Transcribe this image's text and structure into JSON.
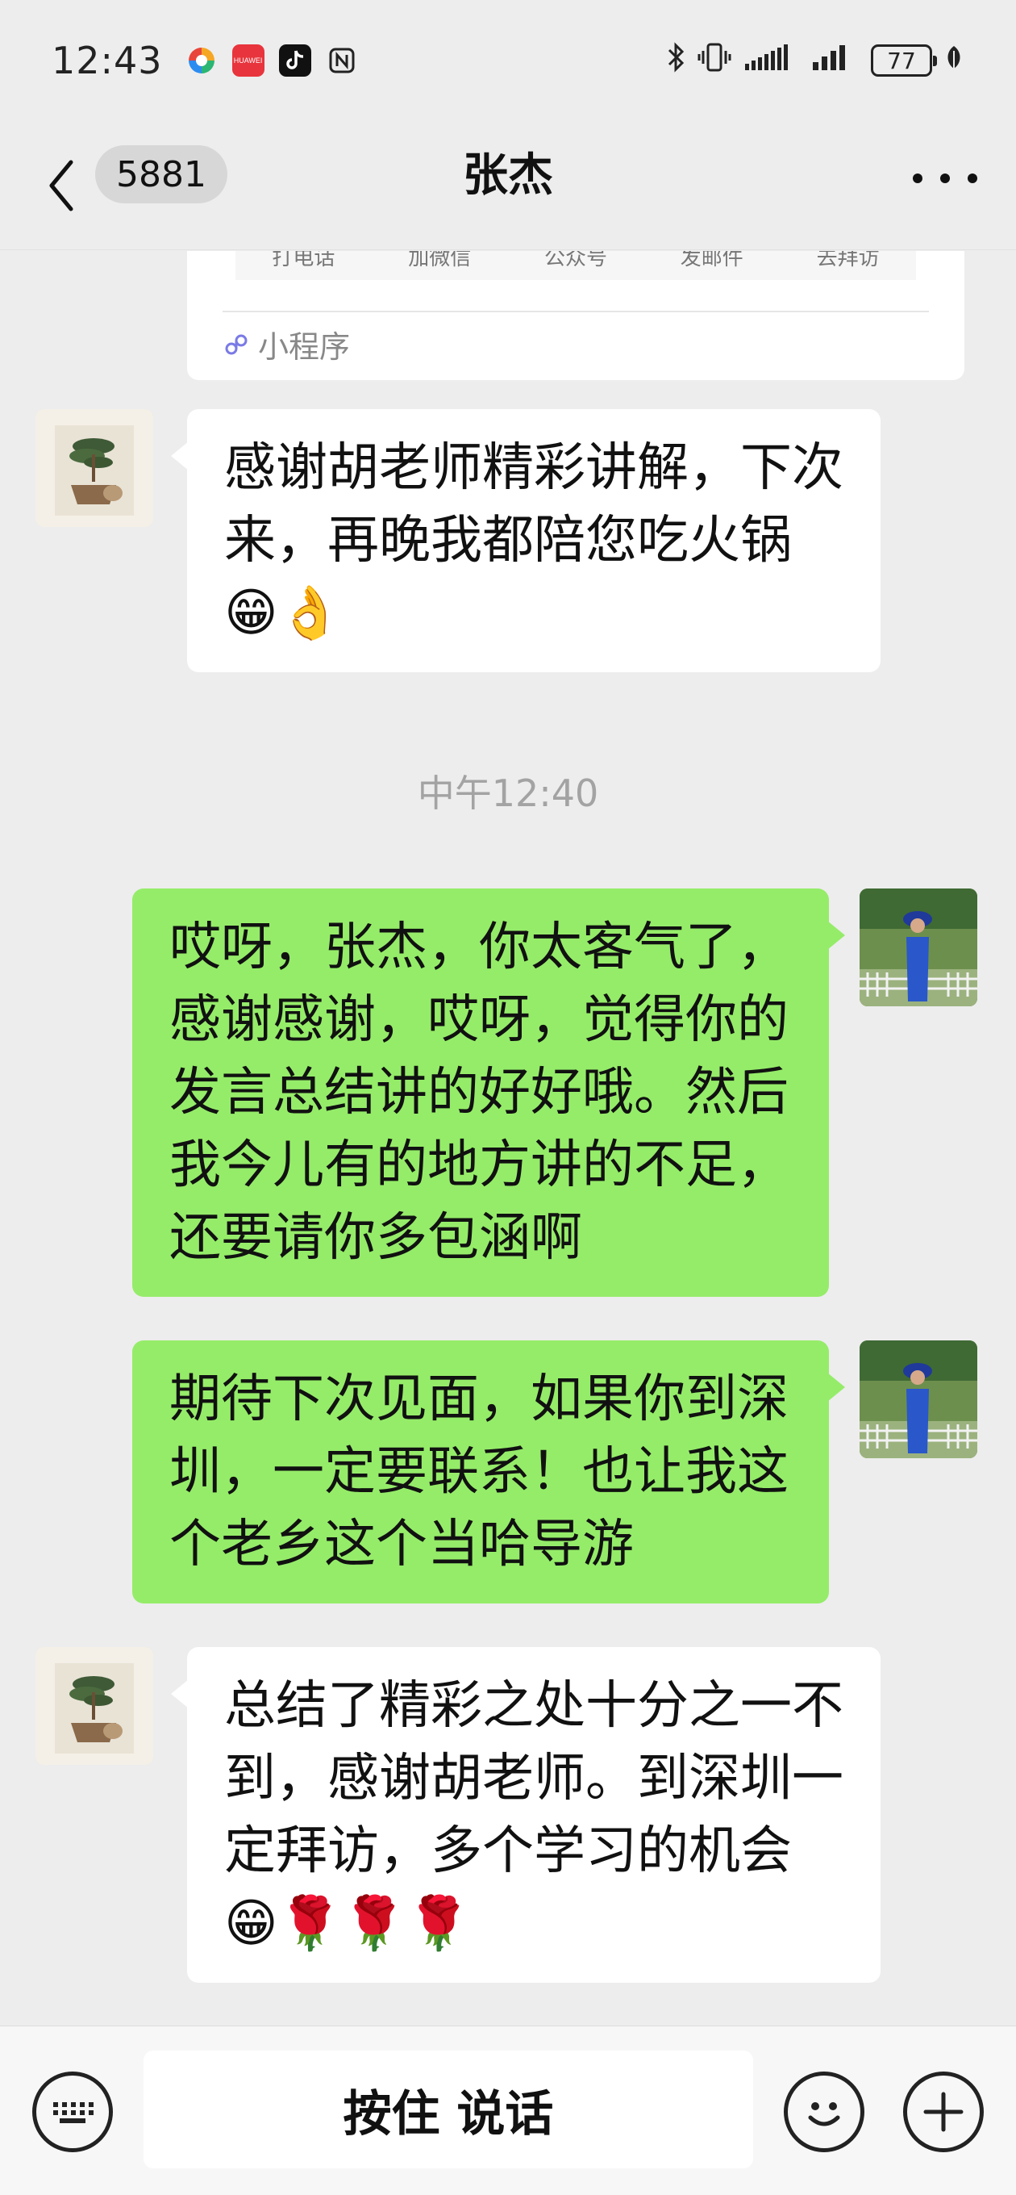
{
  "status_bar": {
    "time": "12:43",
    "battery": "77",
    "huawei_label": "HUAWEI"
  },
  "header": {
    "unread_count": "5881",
    "title": "张杰"
  },
  "mini_program": {
    "actions": [
      "打电话",
      "加微信",
      "公众号",
      "发邮件",
      "去拜访"
    ],
    "label": "小程序"
  },
  "messages": [
    {
      "side": "left",
      "text": "感谢胡老师精彩讲解，下次来，再晚我都陪您吃火锅😁👌"
    },
    {
      "type": "time",
      "text": "中午12:40"
    },
    {
      "side": "right",
      "text": "哎呀，张杰，你太客气了，感谢感谢，哎呀，觉得你的发言总结讲的好好哦。然后我今儿有的地方讲的不足，还要请你多包涵啊"
    },
    {
      "side": "right",
      "text": "期待下次见面，如果你到深圳，一定要联系！也让我这个老乡这个当哈导游"
    },
    {
      "side": "left",
      "text": "总结了精彩之处十分之一不到，感谢胡老师。到深圳一定拜访，多个学习的机会😁🌹🌹🌹"
    }
  ],
  "input_bar": {
    "hold_to_talk": "按住 说话"
  },
  "icons": {
    "back": "chevron-left-icon",
    "more": "more-dots-icon",
    "keyboard": "keyboard-icon",
    "emoji": "emoji-icon",
    "plus": "plus-icon"
  },
  "colors": {
    "background": "#ededed",
    "bubble_left": "#ffffff",
    "bubble_right": "#95ec69",
    "time_separator": "#a3a3a3"
  }
}
